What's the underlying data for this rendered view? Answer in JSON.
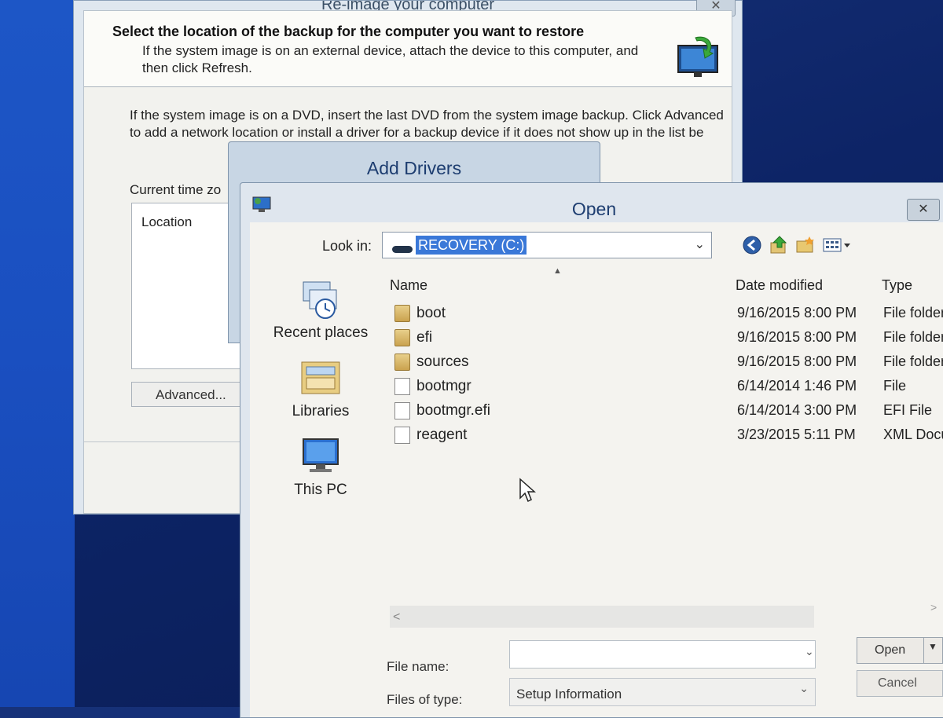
{
  "reimage": {
    "title": "Re-image your computer",
    "close": "✕",
    "heading": "Select the location of the backup for the computer you want to restore",
    "subheading": "If the system image is on an external device, attach the device to this computer, and then click Refresh.",
    "body": "If the system image is on a DVD, insert the last DVD from the system image backup. Click Advanced to add a network location or install a driver for a backup device if it does not show up in the list be",
    "timezone": "Current time zo",
    "location_header": "Location",
    "advanced_button": "Advanced..."
  },
  "add_drivers": {
    "title": "Add Drivers"
  },
  "open_dialog": {
    "title": "Open",
    "close": "✕",
    "look_in_label": "Look in:",
    "look_in_value": "RECOVERY (C:)",
    "places": [
      {
        "label": "Recent places",
        "icon": "recent-places-icon"
      },
      {
        "label": "Libraries",
        "icon": "libraries-icon"
      },
      {
        "label": "This PC",
        "icon": "this-pc-icon"
      }
    ],
    "columns": {
      "name": "Name",
      "date": "Date modified",
      "type": "Type"
    },
    "files": [
      {
        "name": "boot",
        "date": "9/16/2015 8:00 PM",
        "type": "File folder",
        "kind": "folder"
      },
      {
        "name": "efi",
        "date": "9/16/2015 8:00 PM",
        "type": "File folder",
        "kind": "folder"
      },
      {
        "name": "sources",
        "date": "9/16/2015 8:00 PM",
        "type": "File folder",
        "kind": "folder"
      },
      {
        "name": "bootmgr",
        "date": "6/14/2014 1:46 PM",
        "type": "File",
        "kind": "file"
      },
      {
        "name": "bootmgr.efi",
        "date": "6/14/2014 3:00 PM",
        "type": "EFI File",
        "kind": "file"
      },
      {
        "name": "reagent",
        "date": "3/23/2015 5:11 PM",
        "type": "XML Docu",
        "kind": "xml"
      }
    ],
    "file_name_label": "File name:",
    "file_name_value": "",
    "files_of_type_label": "Files of type:",
    "files_of_type_value": "Setup Information",
    "open_button": "Open",
    "cancel_button": "Cancel"
  },
  "colors": {
    "desktop": "#0d2466",
    "selection": "#3a78d8",
    "dialog_bg": "#f4f3ef",
    "title_text": "#1d3d70"
  }
}
